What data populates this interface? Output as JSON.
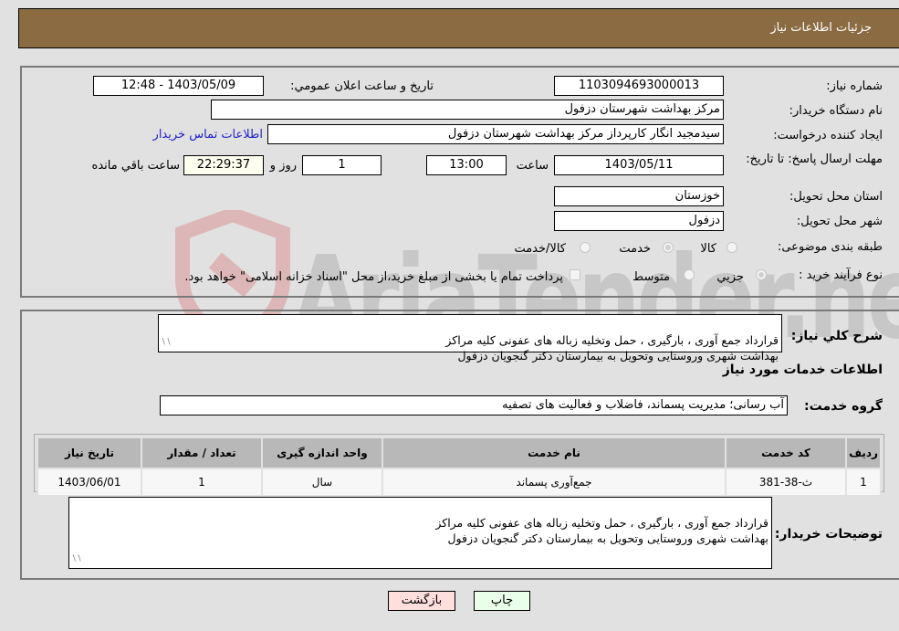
{
  "header": {
    "title": "جزئیات اطلاعات نیاز"
  },
  "form": {
    "need_number": {
      "label": "شماره نیاز:",
      "value": "1103094693000013"
    },
    "announce_datetime": {
      "label": "تاریخ و ساعت اعلان عمومي:",
      "value": "1403/05/09 - 12:48"
    },
    "buyer_org": {
      "label": "نام دستگاه خریدار:",
      "value": "مرکز بهداشت شهرستان دزفول"
    },
    "requester": {
      "label": "ایجاد کننده درخواست:",
      "value": "سیدمجید انگار کارپرداز مرکز بهداشت شهرستان دزفول"
    },
    "contact_link": "اطلاعات تماس خریدار",
    "deadline": {
      "label": "مهلت ارسال پاسخ: تا تاریخ:",
      "date": "1403/05/11",
      "time_label": "ساعت",
      "time": "13:00",
      "days": "1",
      "days_label": "روز و",
      "remaining": "22:29:37",
      "remaining_label": "ساعت باقي مانده"
    },
    "province": {
      "label": "استان محل تحویل:",
      "value": "خوزستان"
    },
    "city": {
      "label": "شهر محل تحویل:",
      "value": "دزفول"
    },
    "category": {
      "label": "طبقه بندی موضوعی:",
      "options": [
        "کالا",
        "خدمت",
        "کالا/خدمت"
      ],
      "selected": "خدمت"
    },
    "purchase_type": {
      "label": "نوع فرآیند خرید :",
      "options": [
        "جزیي",
        "متوسط"
      ],
      "selected": "جزیي",
      "treasury_note": "پرداخت تمام یا بخشی از مبلغ خرید،از محل \"اسناد خزانه اسلامی\" خواهد بود."
    }
  },
  "description": {
    "label": "شرح کلي نیاز:",
    "value": "قرارداد جمع آوری ، بارگیری ، حمل وتخلیه زباله های عفونی کلیه مراکز\nبهداشت شهری وروستایی وتحویل به بیمارستان دکتر گنجویان دزفول"
  },
  "services": {
    "section_title": "اطلاعات خدمات مورد نیاز",
    "group_label": "گروه خدمت:",
    "group_value": "آب رسانی؛ مدیریت پسماند، فاضلاب و فعالیت های تصفیه",
    "columns": [
      "ردیف",
      "کد خدمت",
      "نام خدمت",
      "واحد اندازه گیری",
      "تعداد / مقدار",
      "تاریخ نیاز"
    ],
    "rows": [
      [
        "1",
        "ث-38-381",
        "جمع‌آوری پسماند",
        "سال",
        "1",
        "1403/06/01"
      ]
    ]
  },
  "buyer_notes": {
    "label": "توضیحات خریدار:",
    "value": "قرارداد جمع آوری ، بارگیری ، حمل وتخلیه زباله های عفونی کلیه مراکز\nبهداشت شهری وروستایی وتحویل به بیمارستان دکتر گنجویان دزفول"
  },
  "buttons": {
    "print": "چاپ",
    "back": "بازگشت"
  },
  "watermark": "AriaTender.neT",
  "colors": {
    "header_bg": "#8b6c42",
    "back_btn": "#ffdede",
    "print_btn": "#eaffea",
    "link": "#2222cc"
  }
}
